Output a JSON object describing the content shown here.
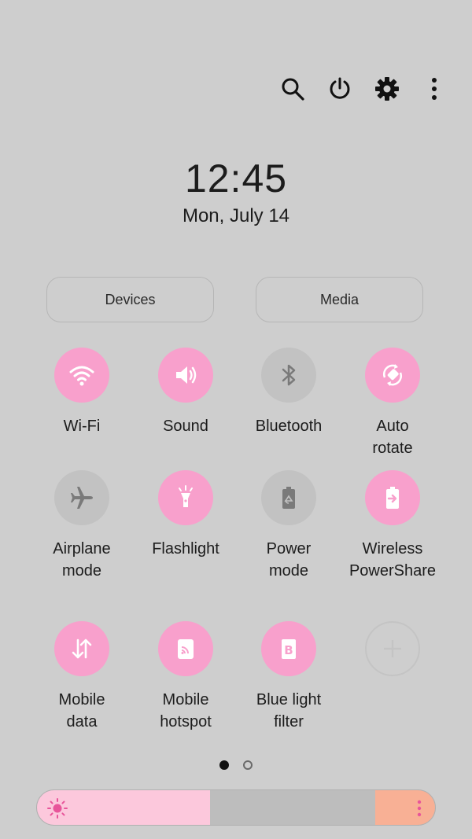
{
  "clock": {
    "time": "12:45",
    "date": "Mon, July 14"
  },
  "top_actions": [
    "search-icon",
    "power-icon",
    "gear-icon",
    "more-vertical-icon"
  ],
  "pills": {
    "devices": "Devices",
    "media": "Media"
  },
  "tiles": [
    {
      "label": "Wi-Fi",
      "icon": "wifi-icon",
      "on": true
    },
    {
      "label": "Sound",
      "icon": "speaker-icon",
      "on": true
    },
    {
      "label": "Bluetooth",
      "icon": "bluetooth-icon",
      "on": false
    },
    {
      "label": "Auto\nrotate",
      "icon": "auto-rotate-icon",
      "on": true
    },
    {
      "label": "Airplane\nmode",
      "icon": "airplane-icon",
      "on": false
    },
    {
      "label": "Flashlight",
      "icon": "flashlight-icon",
      "on": true
    },
    {
      "label": "Power\nmode",
      "icon": "battery-recycle-icon",
      "on": false
    },
    {
      "label": "Wireless\nPowerShare",
      "icon": "powershare-icon",
      "on": true
    },
    {
      "label": "Mobile\ndata",
      "icon": "data-arrows-icon",
      "on": true
    },
    {
      "label": "Mobile\nhotspot",
      "icon": "hotspot-icon",
      "on": true
    },
    {
      "label": "Blue light\nfilter",
      "icon": "blue-light-icon",
      "on": true
    },
    {
      "label": "",
      "icon": "plus-icon",
      "on": false
    }
  ],
  "pagination": {
    "pages": 2,
    "current": 1
  },
  "brightness": {
    "level": 0.435
  },
  "colors": {
    "accent": "#f8a0cc",
    "background": "#cecece",
    "brightness_fill": "#fcc8dc",
    "brightness_end": "#f8b095"
  }
}
